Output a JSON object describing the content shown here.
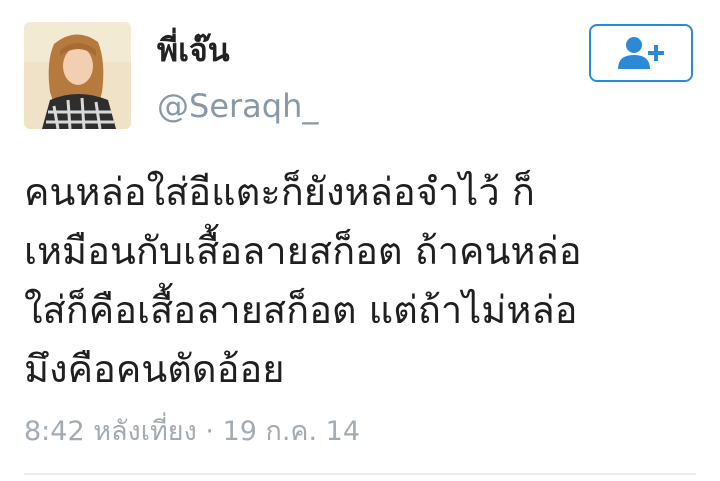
{
  "user": {
    "display_name": "พี่เจ๊น",
    "handle": "@Seraqh_"
  },
  "follow_button": {
    "icon": "add-user-icon",
    "color": "#2b8ad6"
  },
  "tweet": {
    "lines": [
      "คนหล่อใส่อีแตะก็ยังหล่อจำไว้ ก็",
      "เหมือนกับเสื้อลายสก็อต ถ้าคนหล่อ",
      "ใส่ก็คือเสื้อลายสก็อต แต่ถ้าไม่หล่อ",
      "มึงคือคนตัดอ้อย"
    ],
    "time": "8:42 หลังเที่ยง",
    "separator": "·",
    "date": "19 ก.ค. 14"
  }
}
